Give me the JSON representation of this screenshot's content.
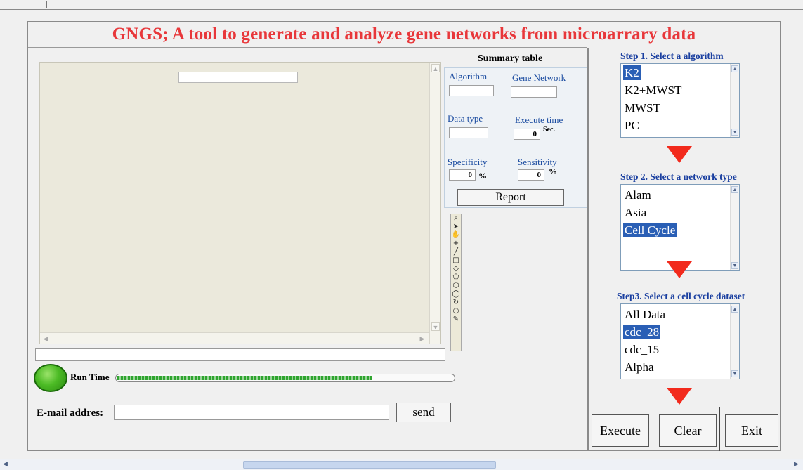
{
  "app": {
    "title": "GNGS; A tool to generate and analyze gene networks from microarrary data"
  },
  "summary": {
    "title": "Summary table",
    "algorithm_label": "Algorithm",
    "algorithm_value": "",
    "gene_network_label": "Gene Network",
    "gene_network_value": "",
    "data_type_label": "Data type",
    "data_type_value": "",
    "execute_time_label": "Execute time",
    "execute_time_value": "0",
    "execute_time_unit": "Sec.",
    "specificity_label": "Specificity",
    "specificity_value": "0",
    "specificity_unit": "%",
    "sensitivity_label": "Sensitivity",
    "sensitivity_value": "0",
    "sensitivity_unit": "%",
    "report_label": "Report"
  },
  "run": {
    "label": "Run Time",
    "progress_fraction": 0.76,
    "status_color": "#4cbb25"
  },
  "email": {
    "label": "E-mail addres:",
    "value": "",
    "send_label": "send"
  },
  "step1": {
    "title": "Step 1. Select a algorithm",
    "items": [
      "K2",
      "K2+MWST",
      "MWST",
      "PC"
    ],
    "selected": "K2"
  },
  "step2": {
    "title": "Step 2. Select a network type",
    "items": [
      "Alam",
      "Asia",
      "Cell Cycle"
    ],
    "selected": "Cell Cycle"
  },
  "step3": {
    "title": "Step3. Select a cell cycle dataset",
    "items": [
      "All Data",
      "cdc_28",
      "cdc_15",
      "Alpha"
    ],
    "selected": "cdc_28"
  },
  "actions": {
    "execute_label": "Execute",
    "clear_label": "Clear",
    "exit_label": "Exit"
  },
  "plot_tools": [
    "zoom-icon",
    "pointer-icon",
    "pan-hand-icon",
    "crosshair-icon",
    "line-icon",
    "rectangle-icon",
    "diamond-icon",
    "polygon-icon",
    "freeform-icon",
    "lasso-icon",
    "rotate-icon",
    "circle-icon",
    "data-cursor-icon"
  ],
  "colors": {
    "title": "#e8373a",
    "step_title": "#1a3fa0",
    "selection": "#2a5fb5",
    "arrow": "#f22a1c"
  }
}
